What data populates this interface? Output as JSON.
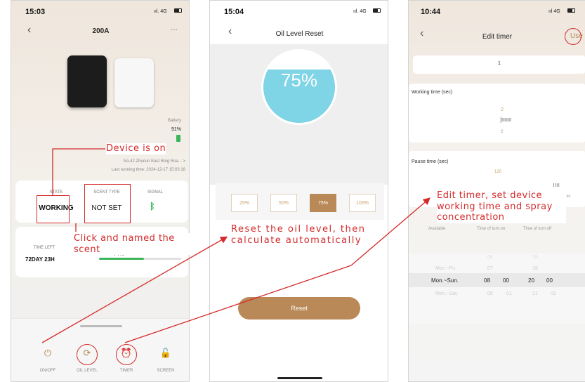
{
  "colors": {
    "annotation": "#d42a2a",
    "accent": "#b98a57",
    "liquid": "#7fd4e6",
    "progress": "#3cb55a",
    "battery": "#3cb55a"
  },
  "phone1": {
    "status_time": "15:03",
    "status_signal": "ııl. 4G",
    "title": "200A",
    "more": "···",
    "battery_label": "Battery",
    "battery_value": "91%",
    "address": "No.42 Zhucun East Ring Roa... >",
    "last_running": "Last running time: 2024-12-17 15:03:18",
    "state_label": "STATE",
    "state_value": "WORKING",
    "scent_label": "SCENT TYPE",
    "scent_value": "NOT SET",
    "signal_label": "SIGNAL",
    "signal_icon": "bluetooth-icon",
    "time_left_label": "TIME LEFT",
    "time_left_value": "72DAY 23H",
    "oil_percent_partial": "74%",
    "oil_progress": 0.55,
    "bottom_buttons": [
      {
        "icon": "power-icon",
        "label": "ON/OFF"
      },
      {
        "icon": "refresh-icon",
        "label": "OIL LEVEL"
      },
      {
        "icon": "alarm-clock-icon",
        "label": "TIMER"
      },
      {
        "icon": "unlock-icon",
        "label": "SCREEN"
      }
    ]
  },
  "phone2": {
    "status_time": "15:04",
    "status_signal": "ııl. 4G",
    "title": "Oil Level Reset",
    "level": "75%",
    "options": [
      "25%",
      "50%",
      "75%",
      "100%"
    ],
    "selected_option": "75%",
    "reset_label": "Reset"
  },
  "phone3": {
    "status_time": "10:44",
    "status_signal": "ııl 4G",
    "title": "Edit timer",
    "use_label": "Use",
    "timer_name": "1",
    "working_label": "Working time (sec)",
    "working_top": "2",
    "working_bottom": "2",
    "pause_label": "Pause time (sec)",
    "pause_top": "120",
    "pause_side": "140",
    "col_available": "Available",
    "col_on": "Time of turn on",
    "col_off": "Time of turn off",
    "rows": [
      {
        "day": "",
        "on_h": "06",
        "on_m": "",
        "off_h": "18",
        "off_m": ""
      },
      {
        "day": "Mon.~Fri.",
        "on_h": "07",
        "on_m": "",
        "off_h": "19",
        "off_m": ""
      },
      {
        "day": "Mon.~Sun.",
        "on_h": "08",
        "on_m": "00",
        "off_h": "20",
        "off_m": "00"
      },
      {
        "day": "Mon.~Sat.",
        "on_h": "09",
        "on_m": "01",
        "off_h": "21",
        "off_m": "01"
      }
    ]
  },
  "annotations": {
    "device_on": "Device is on",
    "click_named": "Click and named the scent",
    "reset_oil": "Reset the oil level, then calculate automatically",
    "edit_timer": "Edit timer, set device working time and spray concentration"
  }
}
